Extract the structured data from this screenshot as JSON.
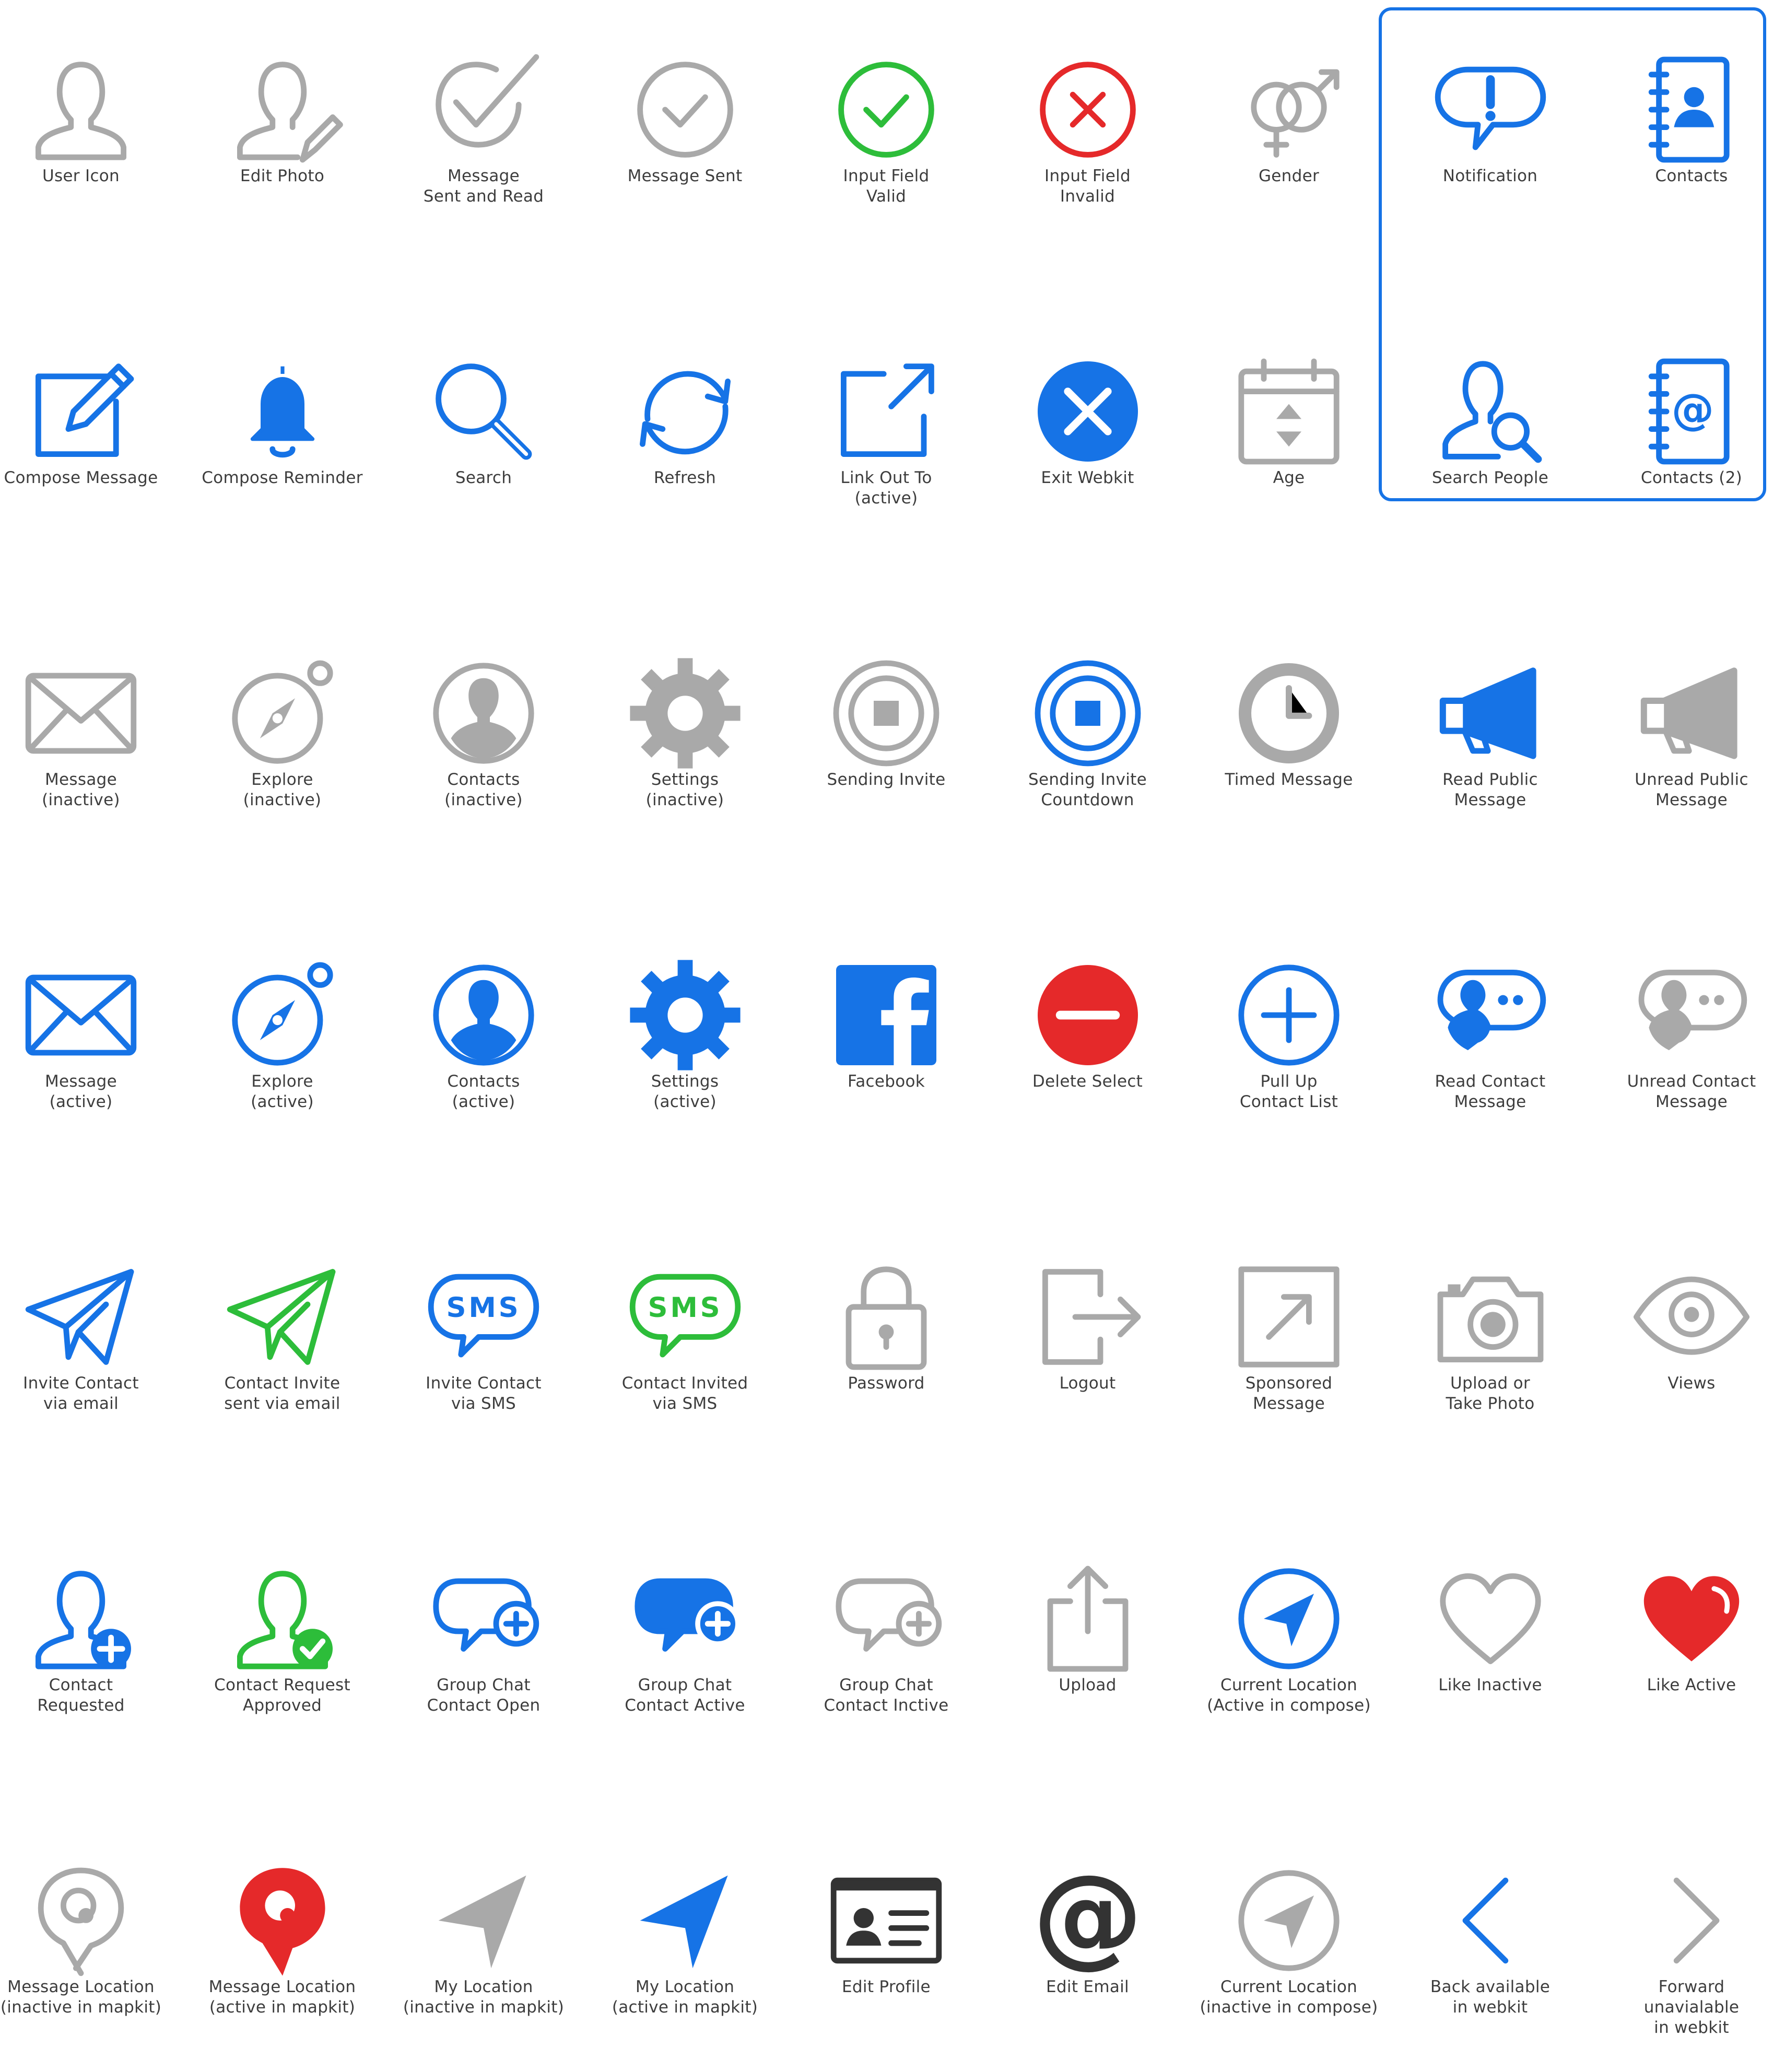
{
  "colors": {
    "blue": "#1673e6",
    "gray": "#a9a9a9",
    "green": "#2dbd3a",
    "red": "#e5292a",
    "dark": "#333333",
    "white": "#ffffff"
  },
  "icons": [
    {
      "name": "user",
      "color": "gray",
      "lines": [
        "User Icon"
      ]
    },
    {
      "name": "edit-photo",
      "color": "gray",
      "lines": [
        "Edit Photo"
      ]
    },
    {
      "name": "check-big",
      "color": "gray",
      "lines": [
        "Message",
        "Sent and Read"
      ]
    },
    {
      "name": "check-circle",
      "color": "gray",
      "lines": [
        "Message Sent"
      ]
    },
    {
      "name": "check-circle",
      "color": "green",
      "lines": [
        "Input Field",
        "Valid"
      ]
    },
    {
      "name": "x-circle",
      "color": "red",
      "lines": [
        "Input Field",
        "Invalid"
      ]
    },
    {
      "name": "gender",
      "color": "gray",
      "lines": [
        "Gender"
      ]
    },
    {
      "name": "notification",
      "color": "blue",
      "lines": [
        "Notification"
      ]
    },
    {
      "name": "contacts-book",
      "color": "blue",
      "lines": [
        "Contacts"
      ]
    },
    {
      "name": "compose",
      "color": "blue",
      "lines": [
        "Compose Message"
      ]
    },
    {
      "name": "bell",
      "color": "blue",
      "lines": [
        "Compose Reminder"
      ]
    },
    {
      "name": "search",
      "color": "blue",
      "lines": [
        "Search"
      ]
    },
    {
      "name": "refresh",
      "color": "blue",
      "lines": [
        "Refresh"
      ]
    },
    {
      "name": "link-out",
      "color": "blue",
      "lines": [
        "Link Out To",
        "(active)"
      ]
    },
    {
      "name": "exit-webkit",
      "color": "blue",
      "lines": [
        "Exit Webkit"
      ]
    },
    {
      "name": "calendar",
      "color": "gray",
      "lines": [
        "Age"
      ]
    },
    {
      "name": "search-people",
      "color": "blue",
      "lines": [
        "Search People"
      ]
    },
    {
      "name": "contacts-at",
      "color": "blue",
      "lines": [
        "Contacts (2)"
      ]
    },
    {
      "name": "envelope",
      "color": "gray",
      "lines": [
        "Message",
        "(inactive)"
      ]
    },
    {
      "name": "compass",
      "color": "gray",
      "lines": [
        "Explore",
        "(inactive)"
      ]
    },
    {
      "name": "contact-circle",
      "color": "gray",
      "lines": [
        "Contacts",
        "(inactive)"
      ]
    },
    {
      "name": "gear",
      "color": "gray",
      "lines": [
        "Settings",
        "(inactive)"
      ]
    },
    {
      "name": "stop-circle",
      "color": "gray",
      "lines": [
        "Sending Invite"
      ]
    },
    {
      "name": "stop-circle",
      "color": "blue",
      "lines": [
        "Sending Invite",
        "Countdown"
      ]
    },
    {
      "name": "clock",
      "color": "gray",
      "lines": [
        "Timed Message"
      ]
    },
    {
      "name": "megaphone",
      "color": "blue",
      "lines": [
        "Read Public",
        "Message"
      ]
    },
    {
      "name": "megaphone",
      "color": "gray",
      "lines": [
        "Unread Public",
        "Message"
      ]
    },
    {
      "name": "envelope",
      "color": "blue",
      "lines": [
        "Message",
        "(active)"
      ]
    },
    {
      "name": "compass",
      "color": "blue",
      "lines": [
        "Explore",
        "(active)"
      ]
    },
    {
      "name": "contact-circle",
      "color": "blue",
      "lines": [
        "Contacts",
        "(active)"
      ]
    },
    {
      "name": "gear",
      "color": "blue",
      "lines": [
        "Settings",
        "(active)"
      ]
    },
    {
      "name": "facebook",
      "color": "blue",
      "lines": [
        "Facebook"
      ]
    },
    {
      "name": "minus-circle",
      "color": "red",
      "lines": [
        "Delete Select"
      ]
    },
    {
      "name": "plus-circle",
      "color": "blue",
      "lines": [
        "Pull Up",
        "Contact List"
      ]
    },
    {
      "name": "contact-bubble",
      "color": "blue",
      "lines": [
        "Read Contact",
        "Message"
      ]
    },
    {
      "name": "contact-bubble",
      "color": "gray",
      "lines": [
        "Unread Contact",
        "Message"
      ]
    },
    {
      "name": "paper-plane",
      "color": "blue",
      "lines": [
        "Invite Contact",
        "via email"
      ]
    },
    {
      "name": "paper-plane",
      "color": "green",
      "lines": [
        "Contact Invite",
        "sent via email"
      ]
    },
    {
      "name": "sms-bubble",
      "color": "blue",
      "lines": [
        "Invite Contact",
        "via SMS"
      ],
      "badge": "SMS"
    },
    {
      "name": "sms-bubble",
      "color": "green",
      "lines": [
        "Contact Invited",
        "via SMS"
      ],
      "badge": "SMS"
    },
    {
      "name": "padlock",
      "color": "gray",
      "lines": [
        "Password"
      ]
    },
    {
      "name": "logout",
      "color": "gray",
      "lines": [
        "Logout"
      ]
    },
    {
      "name": "sponsored",
      "color": "gray",
      "lines": [
        "Sponsored",
        "Message"
      ]
    },
    {
      "name": "camera",
      "color": "gray",
      "lines": [
        "Upload or",
        "Take Photo"
      ]
    },
    {
      "name": "eye",
      "color": "gray",
      "lines": [
        "Views"
      ]
    },
    {
      "name": "user-plus",
      "color": "blue",
      "lines": [
        "Contact",
        "Requested"
      ]
    },
    {
      "name": "user-check",
      "color": "green",
      "lines": [
        "Contact Request",
        "Approved"
      ]
    },
    {
      "name": "chat-plus-outline",
      "color": "blue",
      "lines": [
        "Group Chat",
        "Contact Open"
      ]
    },
    {
      "name": "chat-plus-filled",
      "color": "blue",
      "lines": [
        "Group Chat",
        "Contact Active"
      ]
    },
    {
      "name": "chat-plus-outline",
      "color": "gray",
      "lines": [
        "Group Chat",
        "Contact Inctive"
      ]
    },
    {
      "name": "upload",
      "color": "gray",
      "lines": [
        "Upload"
      ]
    },
    {
      "name": "location-circle",
      "color": "blue",
      "lines": [
        "Current Location",
        "(Active in compose)"
      ]
    },
    {
      "name": "heart-outline",
      "color": "gray",
      "lines": [
        "Like Inactive"
      ]
    },
    {
      "name": "heart-filled",
      "color": "red",
      "lines": [
        "Like Active"
      ]
    },
    {
      "name": "map-pin-outline",
      "color": "gray",
      "lines": [
        "Message Location",
        "(inactive in mapkit)"
      ]
    },
    {
      "name": "map-pin-filled",
      "color": "red",
      "lines": [
        "Message Location",
        "(active in mapkit)"
      ]
    },
    {
      "name": "arrow-location",
      "color": "gray",
      "lines": [
        "My Location",
        "(inactive in mapkit)"
      ]
    },
    {
      "name": "arrow-location",
      "color": "blue",
      "lines": [
        "My Location",
        "(active in mapkit)"
      ]
    },
    {
      "name": "id-card",
      "color": "dark",
      "lines": [
        "Edit Profile"
      ]
    },
    {
      "name": "at-sign",
      "color": "dark",
      "lines": [
        "Edit Email"
      ]
    },
    {
      "name": "location-circle",
      "color": "gray",
      "lines": [
        "Current Location",
        "(inactive in compose)"
      ]
    },
    {
      "name": "chevron-left",
      "color": "blue",
      "lines": [
        "Back available",
        "in webkit"
      ]
    },
    {
      "name": "chevron-right",
      "color": "gray",
      "lines": [
        "Forward",
        "unavialable",
        "in webkit"
      ]
    }
  ]
}
